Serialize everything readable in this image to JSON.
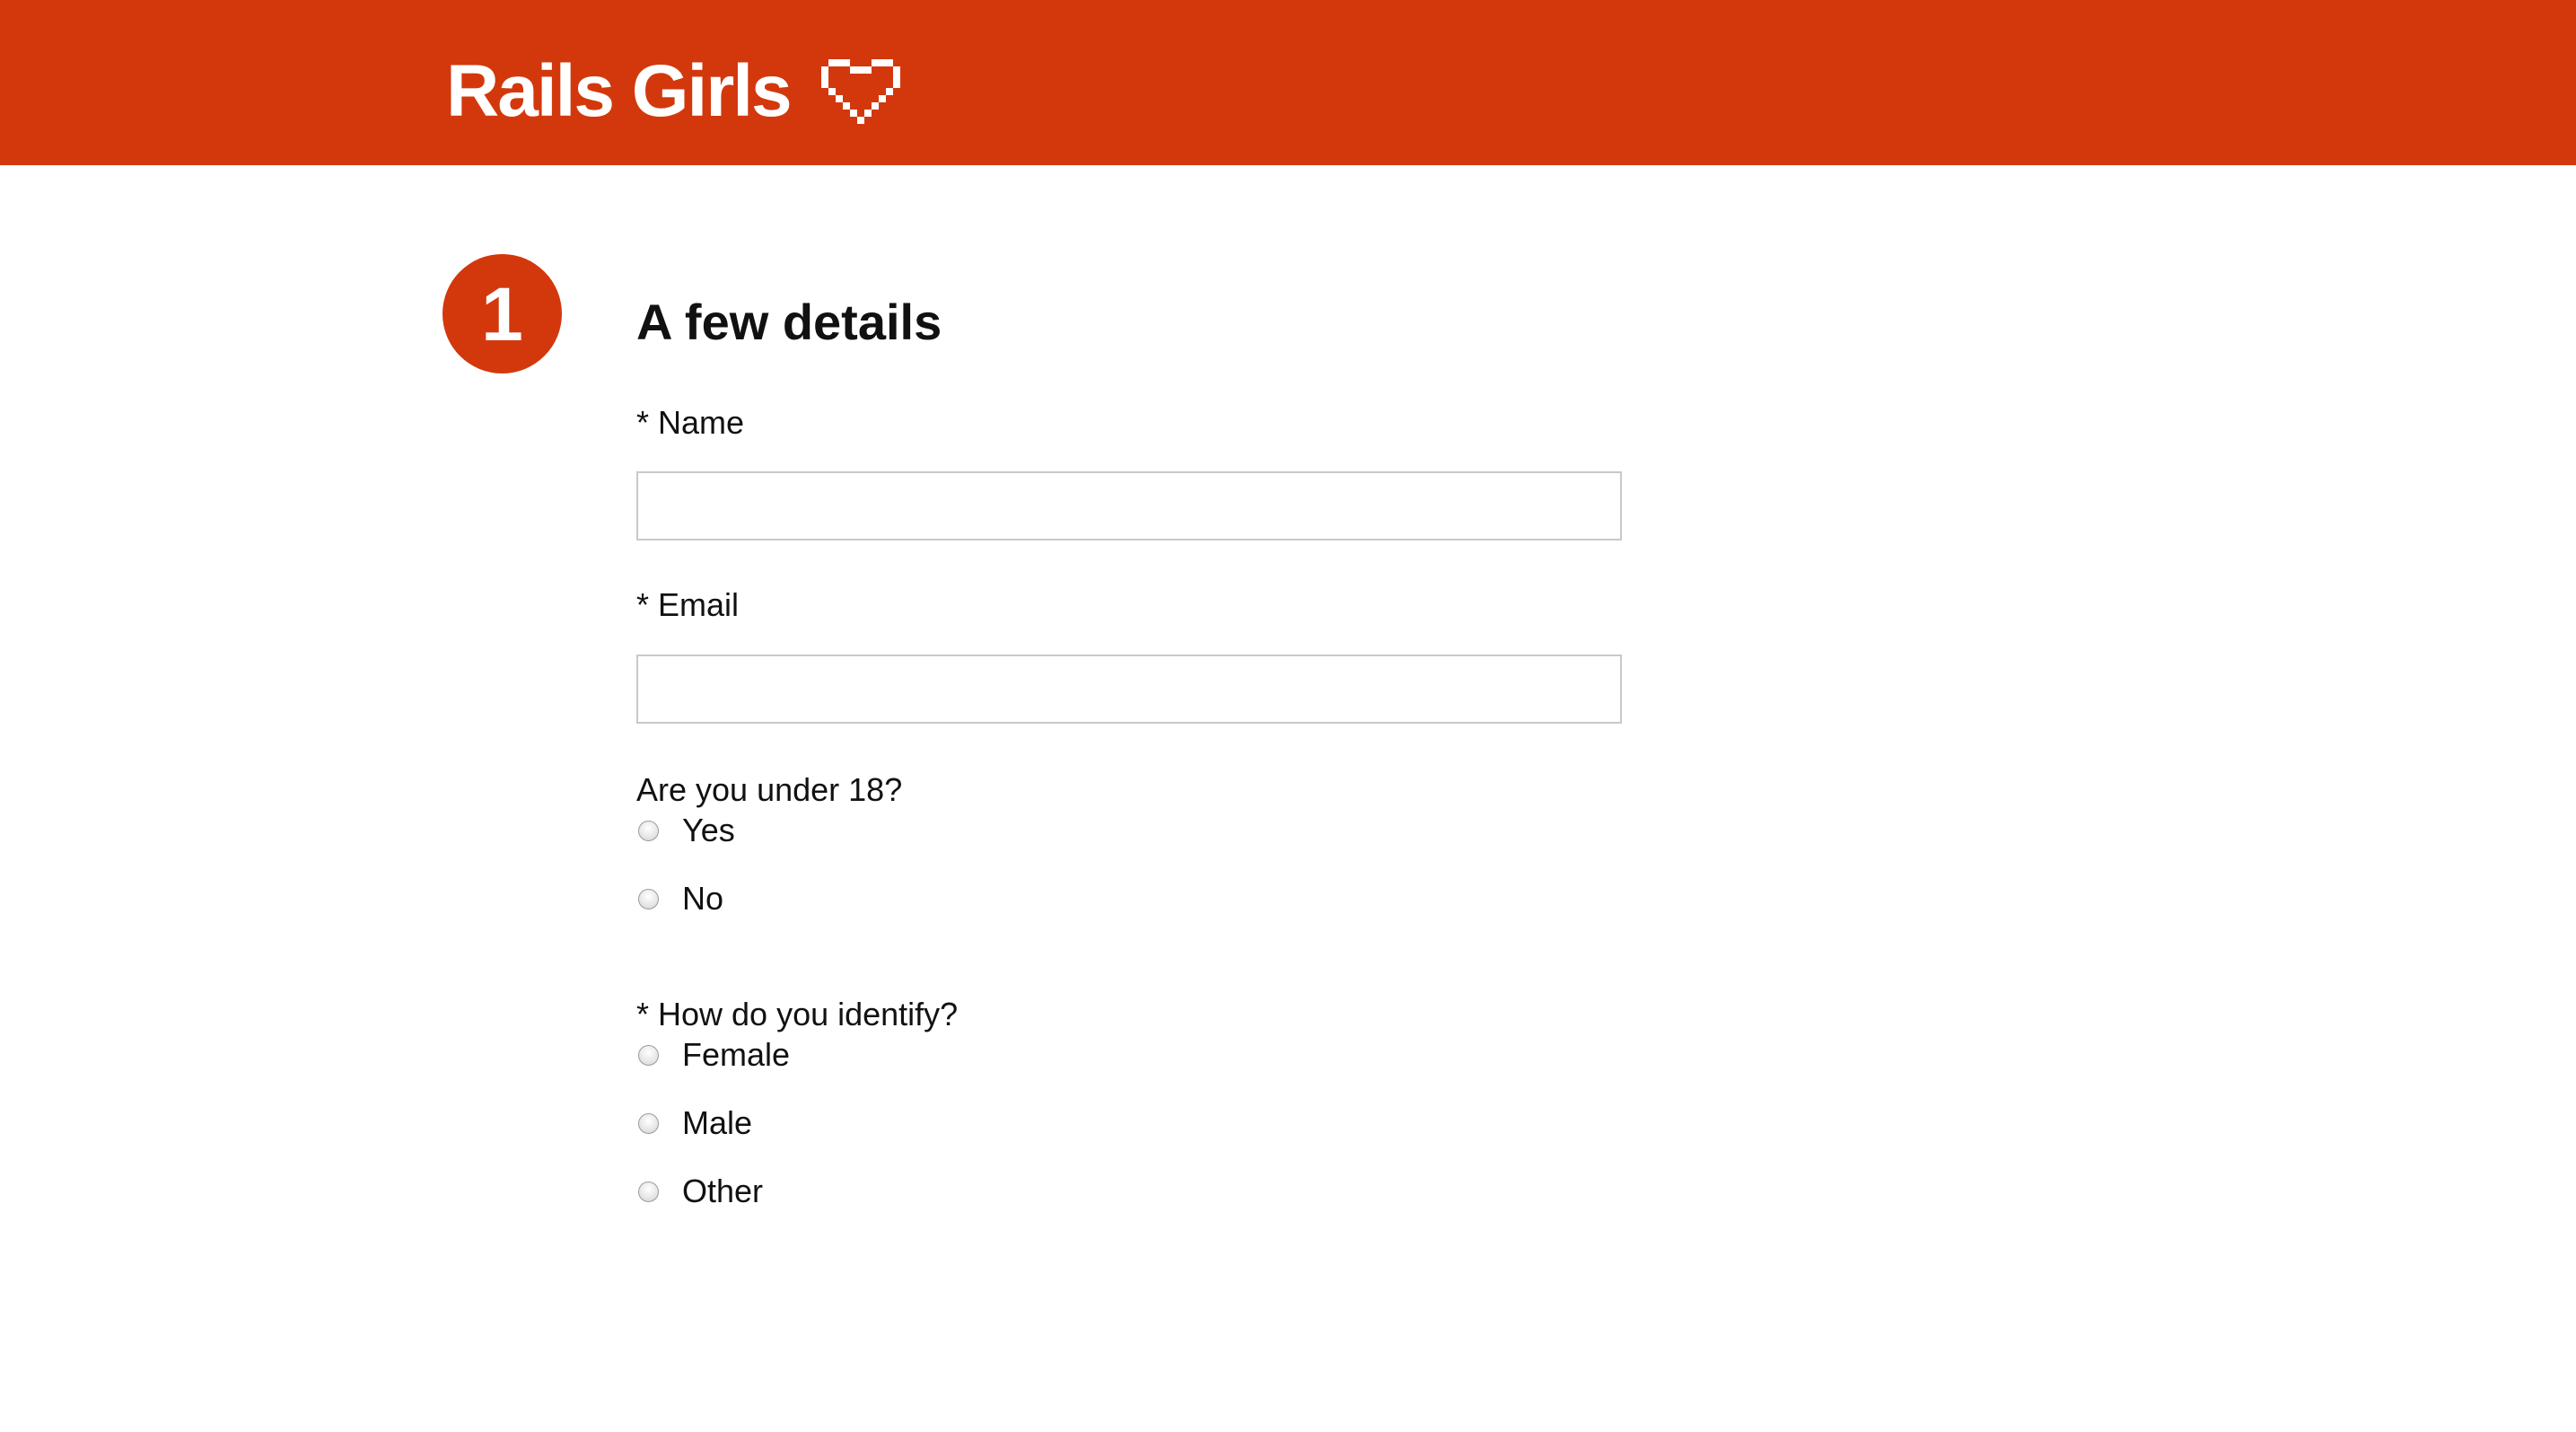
{
  "header": {
    "brand_name": "Rails Girls",
    "brand_icon": "pixel-heart-icon",
    "brand_color": "#d3380d"
  },
  "step": {
    "number": "1",
    "title": "A few details"
  },
  "form": {
    "name": {
      "label": "* Name",
      "value": "",
      "placeholder": ""
    },
    "email": {
      "label": "* Email",
      "value": "",
      "placeholder": ""
    },
    "under18": {
      "question": "Are you under 18?",
      "options": [
        "Yes",
        "No"
      ]
    },
    "identify": {
      "question": "* How do you identify?",
      "options": [
        "Female",
        "Male",
        "Other"
      ]
    }
  }
}
